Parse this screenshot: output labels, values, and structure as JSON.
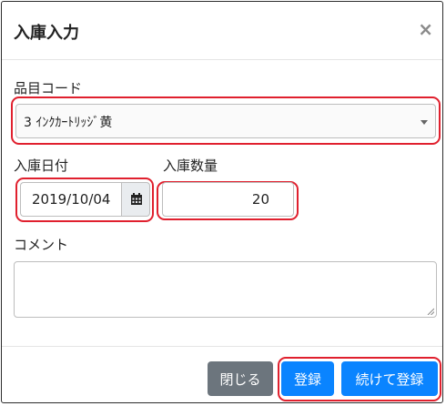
{
  "dialog": {
    "title": "入庫入力",
    "close_symbol": "×"
  },
  "item": {
    "label": "品目コード",
    "selected": "3 ｲﾝｸｶｰﾄﾘｯｼﾞ黄"
  },
  "date": {
    "label": "入庫日付",
    "value": "2019/10/04"
  },
  "quantity": {
    "label": "入庫数量",
    "value": "20"
  },
  "comment": {
    "label": "コメント",
    "value": ""
  },
  "buttons": {
    "close": "閉じる",
    "register": "登録",
    "continue": "続けて登録"
  },
  "colors": {
    "highlight": "#e0202e",
    "primary": "#0a84ff",
    "secondary": "#6c757d"
  }
}
